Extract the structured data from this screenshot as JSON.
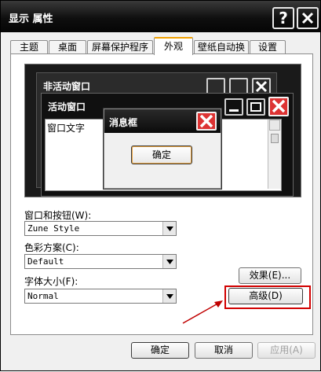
{
  "window": {
    "title": "显示 属性"
  },
  "tabs": [
    {
      "label": "主题"
    },
    {
      "label": "桌面"
    },
    {
      "label": "屏幕保护程序"
    },
    {
      "label": "外观"
    },
    {
      "label": "壁纸自动换"
    },
    {
      "label": "设置"
    }
  ],
  "active_tab": "外观",
  "preview": {
    "inactive_title": "非活动窗口",
    "active_title": "活动窗口",
    "window_text": "窗口文字",
    "message_title": "消息框",
    "ok_label": "确定"
  },
  "form": {
    "windows_buttons_label": "窗口和按钮(W):",
    "windows_buttons_value": "Zune Style",
    "color_scheme_label": "色彩方案(C):",
    "color_scheme_value": "Default",
    "font_size_label": "字体大小(F):",
    "font_size_value": "Normal"
  },
  "buttons": {
    "effects": "效果(E)...",
    "advanced": "高级(D)",
    "ok": "确定",
    "cancel": "取消",
    "apply": "应用(A)"
  },
  "colors": {
    "highlight": "#d10000",
    "focus_accent": "#f0a000"
  }
}
